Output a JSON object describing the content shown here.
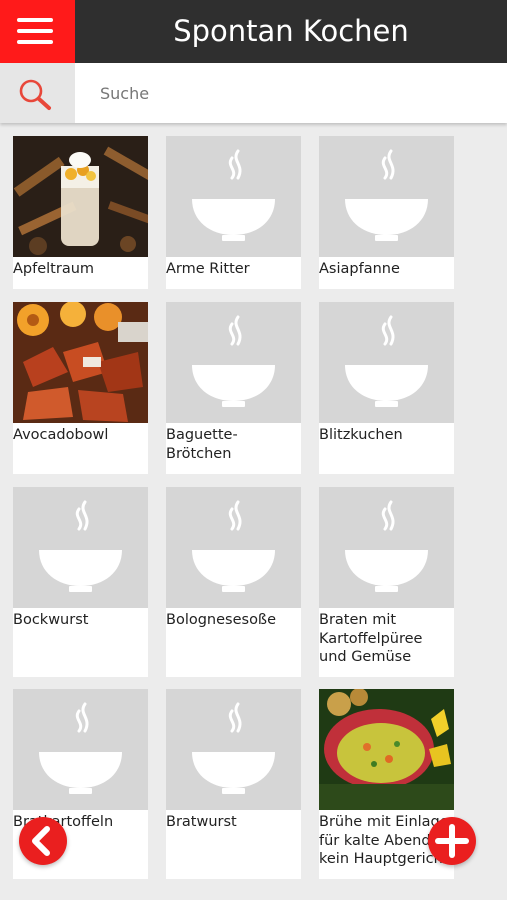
{
  "header": {
    "title": "Spontan Kochen"
  },
  "search": {
    "placeholder": "Suche"
  },
  "recipes": [
    {
      "name": "Apfeltraum",
      "image": "dessert-photo"
    },
    {
      "name": "Arme Ritter",
      "image": "placeholder-bowl"
    },
    {
      "name": "Asiapfanne",
      "image": "placeholder-bowl"
    },
    {
      "name": "Avocadobowl",
      "image": "salad-photo"
    },
    {
      "name": "Baguette-\nBrötchen",
      "image": "placeholder-bowl"
    },
    {
      "name": "Blitzkuchen",
      "image": "placeholder-bowl"
    },
    {
      "name": "Bockwurst",
      "image": "placeholder-bowl"
    },
    {
      "name": "Bolognesesoße",
      "image": "placeholder-bowl"
    },
    {
      "name": "Braten mit\nKartoffelpüree\nund Gemüse",
      "image": "placeholder-bowl"
    },
    {
      "name": "Bratkartoffeln",
      "image": "placeholder-bowl"
    },
    {
      "name": "Bratwurst",
      "image": "placeholder-bowl"
    },
    {
      "name": "Brühe mit Einlage\nfür kalte Abende -\nkein Hauptgericht",
      "image": "soup-photo"
    }
  ],
  "colors": {
    "accent": "#ea1f1f",
    "topbar": "#2f2f2f",
    "placeholder": "#d6d6d6"
  },
  "icons": {
    "menu": "hamburger-icon",
    "search": "search-icon",
    "back": "chevron-left-icon",
    "add": "plus-icon"
  }
}
